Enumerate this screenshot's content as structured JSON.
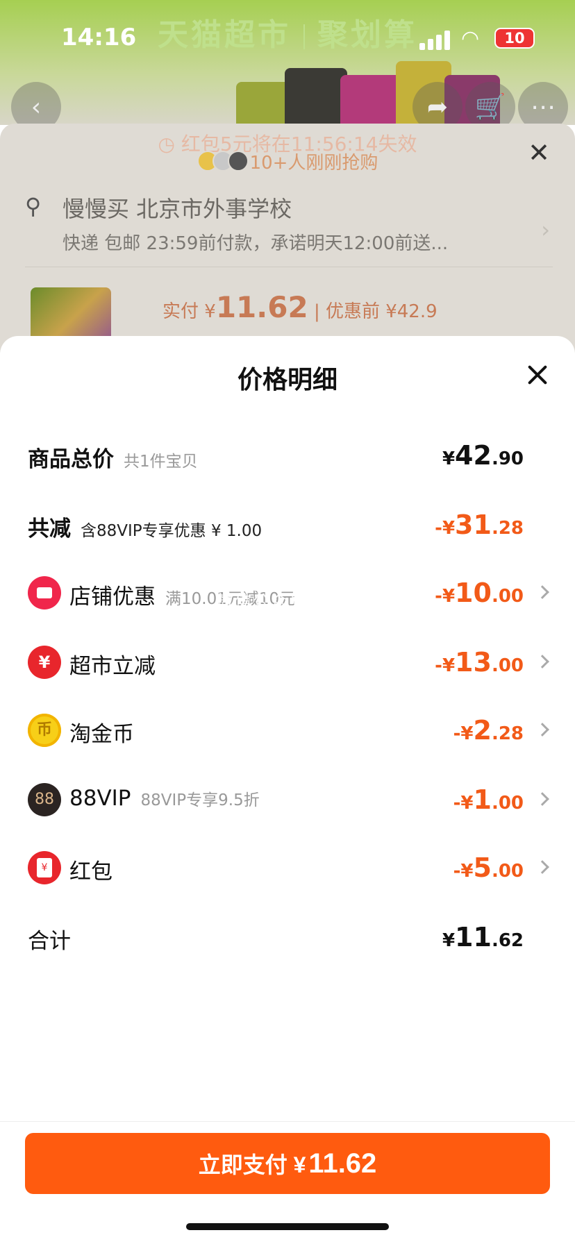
{
  "status_bar": {
    "time": "14:16",
    "battery": "10"
  },
  "background": {
    "banner_left": "天猫超市",
    "banner_right": "聚划算",
    "timer_text": "红包5元将在11:56:14失效",
    "buyers_text": "10+人刚刚抢购",
    "address_name": "慢慢买 北京市外事学校",
    "delivery_text": "快递 包邮 23:59前付款，承诺明天12:00前送...",
    "price_label": "实付 ¥",
    "price_value": "11.62",
    "price_before": "| 优惠前 ¥42.9"
  },
  "sheet": {
    "title": "价格明细",
    "rows": [
      {
        "label": "商品总价",
        "sub": "共1件宝贝",
        "currency": "¥",
        "int": "42",
        "dec": ".90"
      },
      {
        "label": "共减",
        "sub": "含88VIP专享优惠 ¥ 1.00",
        "currency": "-¥",
        "int": "31",
        "dec": ".28"
      },
      {
        "label": "店铺优惠",
        "sub": "满10.01元减10元",
        "currency": "-¥",
        "int": "10",
        "dec": ".00",
        "icon": "shop-icon"
      },
      {
        "label": "超市立减",
        "sub": "",
        "currency": "-¥",
        "int": "13",
        "dec": ".00",
        "icon": "yuan-icon"
      },
      {
        "label": "淘金币",
        "sub": "",
        "currency": "-¥",
        "int": "2",
        "dec": ".28",
        "icon": "coin-icon"
      },
      {
        "label": "88VIP",
        "sub": "88VIP专享9.5折",
        "currency": "-¥",
        "int": "1",
        "dec": ".00",
        "icon": "vip-icon"
      },
      {
        "label": "红包",
        "sub": "",
        "currency": "-¥",
        "int": "5",
        "dec": ".00",
        "icon": "red-envelope-icon"
      },
      {
        "label": "合计",
        "sub": "",
        "currency": "¥",
        "int": "11",
        "dec": ".62"
      }
    ],
    "watermark": "微信公众号·慢慢买",
    "pay_label": "立即支付 ¥",
    "pay_amount": "11.62"
  },
  "colors": {
    "accent_orange": "#ff5b0f",
    "discount_orange": "#f25a18"
  }
}
